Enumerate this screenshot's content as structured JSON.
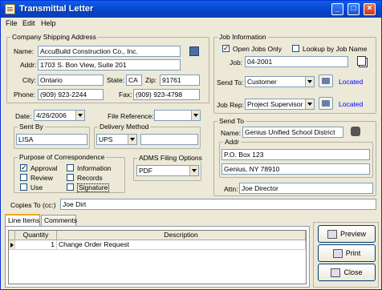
{
  "window": {
    "title": "Transmittal Letter",
    "controls": [
      "_",
      "□",
      "×"
    ]
  },
  "menu": [
    "File",
    "Edit",
    "Help"
  ],
  "company": {
    "group_label": "Company Shipping Address",
    "name_label": "Name:",
    "name_value": "AccuBuild Construction Co., Inc.",
    "addr_label": "Addr:",
    "addr_value": "1703 S. Bon View, Suite 201",
    "city_label": "City:",
    "city_value": "Ontario",
    "state_label": "State:",
    "state_value": "CA",
    "zip_label": "Zip:",
    "zip_value": "91761",
    "phone_label": "Phone:",
    "phone_value": "(909) 923-2244",
    "fax_label": "Fax:",
    "fax_value": "(909) 923-4798"
  },
  "job": {
    "group_label": "Job Information",
    "open_jobs_label": "Open Jobs Only",
    "open_jobs_checked": true,
    "lookup_label": "Lookup by Job Name",
    "lookup_checked": false,
    "job_label": "Job:",
    "job_value": "04-2001",
    "send_to_label": "Send To:",
    "send_to_value": "Customer",
    "send_to_link": "Located",
    "job_rep_label": "Job Rep:",
    "job_rep_value": "Project Supervisor",
    "job_rep_link": "Located"
  },
  "date": {
    "label": "Date:",
    "value": "4/26/2006"
  },
  "file_ref": {
    "label": "File Reference:",
    "value": ""
  },
  "sent_by": {
    "group_label": "Sent By",
    "value": "LISA"
  },
  "delivery": {
    "group_label": "Delivery Method",
    "method": "UPS",
    "extra": ""
  },
  "purpose": {
    "group_label": "Purpose of Correspondence",
    "items": [
      {
        "label": "Approval",
        "checked": true
      },
      {
        "label": "Review",
        "checked": false
      },
      {
        "label": "Use",
        "checked": false
      },
      {
        "label": "Information",
        "checked": false
      },
      {
        "label": "Records",
        "checked": false
      },
      {
        "label": "Signature",
        "checked": false
      }
    ]
  },
  "adms": {
    "group_label": "ADMS Filing Options",
    "value": "PDF"
  },
  "send_to": {
    "group_label": "Send To",
    "name_label": "Name:",
    "name_value": "Genius Unified School District",
    "addr_label": "Addr",
    "addr_line1": "P.O. Box 123",
    "addr_line2": "Genius, NY 78910",
    "attn_label": "Attn:",
    "attn_value": "Joe Director"
  },
  "copies": {
    "label": "Copies To (cc:)",
    "value": "Joe Dirt"
  },
  "tabs": [
    "Line Items",
    "Comments"
  ],
  "grid": {
    "headers": [
      "Quantity",
      "Description"
    ],
    "rows": [
      {
        "quantity": "1",
        "description": "Change Order Request"
      }
    ]
  },
  "buttons": {
    "preview": "Preview",
    "print": "Print",
    "close": "Close"
  }
}
